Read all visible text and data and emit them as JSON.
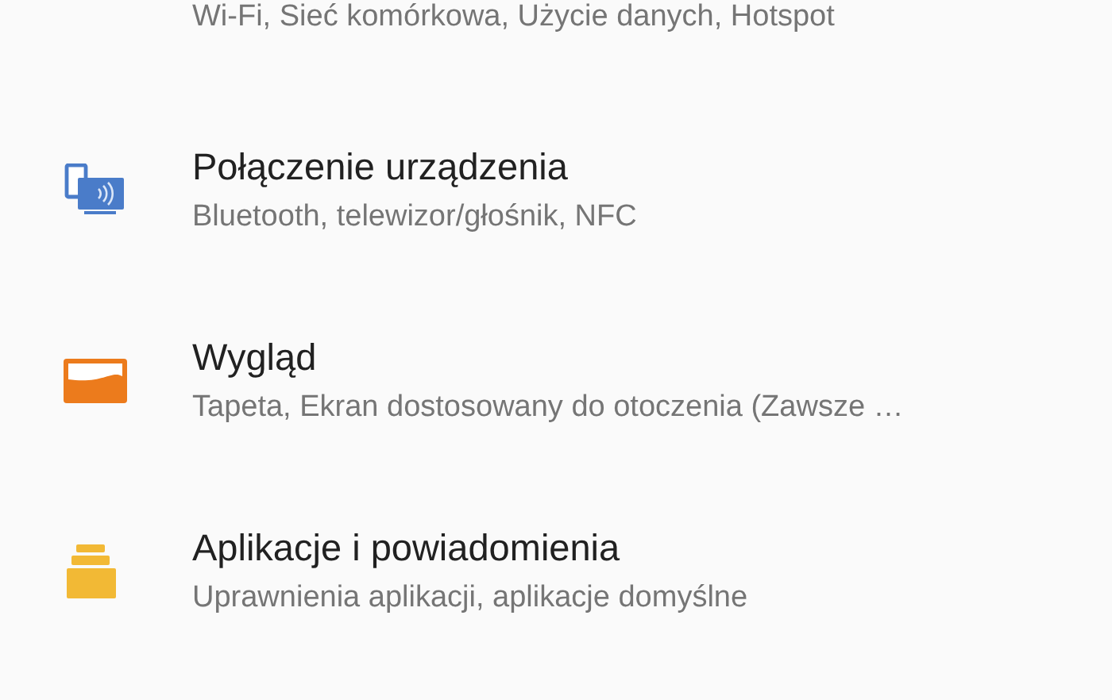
{
  "settings_items": [
    {
      "summary": "Wi-Fi, Sieć komórkowa, Użycie danych, Hotspot"
    },
    {
      "title": "Połączenie urządzenia",
      "summary": "Bluetooth, telewizor/głośnik, NFC"
    },
    {
      "title": "Wygląd",
      "summary": "Tapeta, Ekran dostosowany do otoczenia (Zawsze …"
    },
    {
      "title": "Aplikacje i powiadomienia",
      "summary": "Uprawnienia aplikacji, aplikacje domyślne"
    }
  ]
}
